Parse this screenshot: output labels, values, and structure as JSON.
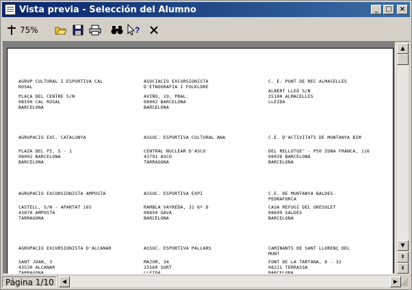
{
  "window": {
    "title": "Vista previa - Selección del Alumno"
  },
  "titlebar": {
    "minimize_glyph": "_",
    "maximize_glyph": "□",
    "close_glyph": "×"
  },
  "toolbar": {
    "zoom_label": "75%",
    "icons": [
      "zoom-pin-icon",
      "open-folder-icon",
      "save-disk-icon",
      "print-icon",
      "find-binoculars-icon",
      "help-pointer-icon",
      "close-x-icon"
    ]
  },
  "entries": [
    {
      "name": "AGRUP CULTURAL I ESPORTIVA CAL\nROSAL",
      "address": "PLAÇA DEL CENTRE S/N\n08590 CAL ROSAL\nBARCELONA"
    },
    {
      "name": "ASOCIACIO EXCURSIONISTA\nD'ETNOGRAFIA I FOLKLORE",
      "address": "AVIÑO, 19, PRAL.\n08002 BARCELONA\nBARCELONA"
    },
    {
      "name": "C. E. PUNT DE REC ALMACELLES",
      "address": "ALBERT LLEÓ S/N\n25100 ALMACELLES\nLLEIDA"
    },
    {
      "name": "AGRUPACIO EXC. CATALUNYA",
      "address": "PLAZA DEL PI, 5 - 1\n08002 BARCELONA\nBARCELONA"
    },
    {
      "name": "ASSOC. ESPORTIVA CULTURAL ANA",
      "address": "CENTRAL NUCLEAR D'ASCO\n43791 ASCO\nTARRAGONA"
    },
    {
      "name": "C.E. D'ACTIVITATS DE MUNTANYA BIM",
      "address": "DEL RELLOTGE\" - P50 ZONA FRANCA, 116\n08038 BARCELONA\nBARCELONA"
    },
    {
      "name": "AGRUPACIO EXCURSIONISTA AMPOSTA",
      "address": "CASTELL, S/N - APARTAT 165\n43870 AMPOSTA\nTARRAGONA"
    },
    {
      "name": "ASSOC. ESPORTIVA EXPI",
      "address": "RAMBLA VAYREDA, 31 6º D\n08850 GAVA\nBARCELONA"
    },
    {
      "name": "C.E. DE MUNTANYA BALDES-\nPEDRAFORCA",
      "address": "CASA REFUGI DEL GRESOLET\n08699 SALDES\nBARCELONA"
    },
    {
      "name": "AGRUPACIO EXCURSIONISTA D'ALCANAR",
      "address": "SANT JOAN, 3\n43530 ALCANAR\nTARRAGONA"
    },
    {
      "name": "ASSOC. ESPORTIVA PALLARS",
      "address": "MAJOR, 34\n25560 SORT\nLLEIDA"
    },
    {
      "name": "CAMINANTS DE SANT LLORENÇ DEL\nMUNT",
      "address": "FONT DE LA TARTANA, 6 - 32\n08221 TERRASSA\nBARCELONA"
    }
  ],
  "status": {
    "page": "Página 1/10"
  },
  "scroll": {
    "up": "▲",
    "down": "▼",
    "page_up": "⇞",
    "page_down": "⇟",
    "left": "◀",
    "right": "▶"
  }
}
